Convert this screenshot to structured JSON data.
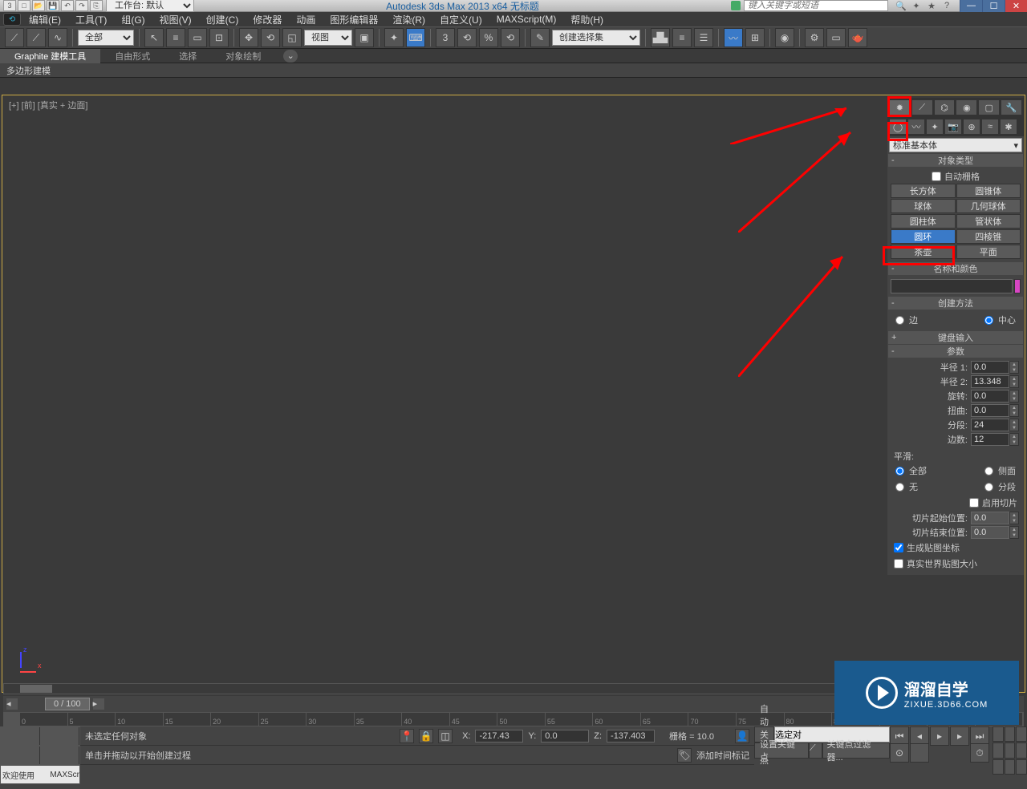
{
  "titlebar": {
    "workspace_label": "工作台: 默认",
    "app_title": "Autodesk 3ds Max  2013 x64     无标题",
    "search_placeholder": "键入关键字或短语"
  },
  "menu": {
    "items": [
      "编辑(E)",
      "工具(T)",
      "组(G)",
      "视图(V)",
      "创建(C)",
      "修改器",
      "动画",
      "图形编辑器",
      "渲染(R)",
      "自定义(U)",
      "MAXScript(M)",
      "帮助(H)"
    ]
  },
  "toolbar": {
    "filter": "全部",
    "view_mode": "视图",
    "selset": "创建选择集"
  },
  "ribbon": {
    "tabs": [
      "Graphite 建模工具",
      "自由形式",
      "选择",
      "对象绘制"
    ],
    "sub": "多边形建模"
  },
  "viewport": {
    "label": "[+] [前] [真实 + 边面]"
  },
  "panel": {
    "geometry_type": "标准基本体",
    "rollout_object_type": "对象类型",
    "auto_grid": "自动栅格",
    "buttons": [
      [
        "长方体",
        "圆锥体"
      ],
      [
        "球体",
        "几何球体"
      ],
      [
        "圆柱体",
        "管状体"
      ],
      [
        "圆环",
        "四棱锥"
      ],
      [
        "茶壶",
        "平面"
      ]
    ],
    "rollout_name_color": "名称和颜色",
    "rollout_create_method": "创建方法",
    "create_edge": "边",
    "create_center": "中心",
    "rollout_keyboard": "键盘输入",
    "rollout_params": "参数",
    "params": {
      "radius1_label": "半径 1:",
      "radius1": "0.0",
      "radius2_label": "半径 2:",
      "radius2": "13.348",
      "rotation_label": "旋转:",
      "rotation": "0.0",
      "twist_label": "扭曲:",
      "twist": "0.0",
      "segments_label": "分段:",
      "segments": "24",
      "sides_label": "边数:",
      "sides": "12"
    },
    "smooth_label": "平滑:",
    "smooth_all": "全部",
    "smooth_sides": "侧面",
    "smooth_none": "无",
    "smooth_segs": "分段",
    "slice_on": "启用切片",
    "slice_from_label": "切片起始位置:",
    "slice_from": "0.0",
    "slice_to_label": "切片结束位置:",
    "slice_to": "0.0",
    "gen_map": "生成贴图坐标",
    "real_world": "真实世界贴图大小"
  },
  "time": {
    "slider": "0 / 100"
  },
  "status": {
    "welcome": "欢迎使用",
    "maxscr": "MAXScr",
    "no_sel": "未选定任何对象",
    "prompt": "单击并拖动以开始创建过程",
    "x": "-217.43",
    "y": "0.0",
    "z": "-137.403",
    "grid": "栅格 = 10.0",
    "addtime": "添加时间标记",
    "autokey": "自动关键点",
    "setkey": "设置关键点",
    "selset": "选定对",
    "keyfilter": "关键点过滤器..."
  },
  "watermark": {
    "title": "溜溜自学",
    "url": "ZIXUE.3D66.COM"
  }
}
